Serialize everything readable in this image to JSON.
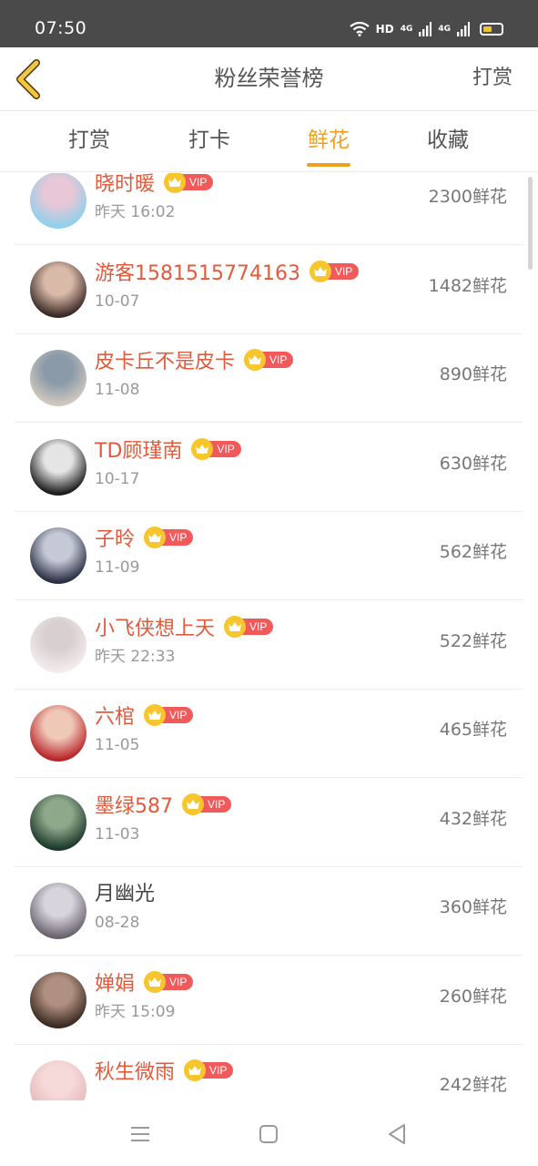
{
  "status": {
    "time": "07:50",
    "network": "HD",
    "signal1": "4G",
    "signal2": "4G"
  },
  "header": {
    "title": "粉丝荣誉榜",
    "action_label": "打赏",
    "back_icon": "chevron-left-icon"
  },
  "tabs": [
    {
      "label": "打赏",
      "active": false
    },
    {
      "label": "打卡",
      "active": false
    },
    {
      "label": "鲜花",
      "active": true
    },
    {
      "label": "收藏",
      "active": false
    }
  ],
  "vip_badge": {
    "label": "VIP",
    "icon": "crown-icon"
  },
  "colors": {
    "accent": "#f0a020",
    "vip_name": "#e05a3b",
    "vip_pill": "#f05a5a",
    "crown": "#f7c52c"
  },
  "fans": [
    {
      "name": "晓时暖",
      "date": "昨天 16:02",
      "amount": "2300鲜花",
      "vip": true
    },
    {
      "name": "游客1581515774163",
      "date": "10-07",
      "amount": "1482鲜花",
      "vip": true
    },
    {
      "name": "皮卡丘不是皮卡",
      "date": "11-08",
      "amount": "890鲜花",
      "vip": true
    },
    {
      "name": "TD顾瑾南",
      "date": "10-17",
      "amount": "630鲜花",
      "vip": true
    },
    {
      "name": "子昤",
      "date": "11-09",
      "amount": "562鲜花",
      "vip": true
    },
    {
      "name": "小飞侠想上天",
      "date": "昨天 22:33",
      "amount": "522鲜花",
      "vip": true
    },
    {
      "name": "六棺",
      "date": "11-05",
      "amount": "465鲜花",
      "vip": true
    },
    {
      "name": "墨绿587",
      "date": "11-03",
      "amount": "432鲜花",
      "vip": true
    },
    {
      "name": "月幽光",
      "date": "08-28",
      "amount": "360鲜花",
      "vip": false
    },
    {
      "name": "婵娟",
      "date": "昨天 15:09",
      "amount": "260鲜花",
      "vip": true
    },
    {
      "name": "秋生微雨",
      "date": "",
      "amount": "242鲜花",
      "vip": true
    }
  ],
  "nav": [
    "menu-icon",
    "home-icon",
    "back-icon"
  ]
}
